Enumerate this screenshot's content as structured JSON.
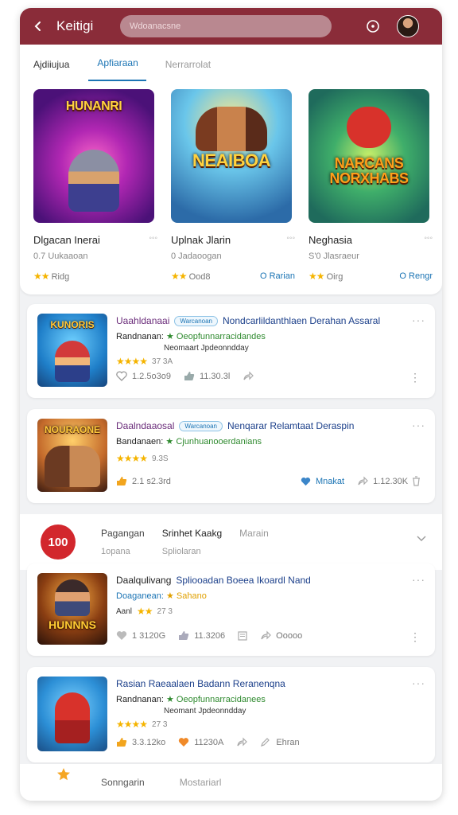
{
  "header": {
    "back_icon": "chevron-left-icon",
    "title": "Keitigi",
    "search_placeholder": "Wdoanacsne",
    "info_icon": "info-circle-icon",
    "avatar_icon": "user-avatar"
  },
  "tabs": [
    {
      "label": "Ajdiiujua"
    },
    {
      "label": "Apfiaraan"
    },
    {
      "label": "Nerrarrolat"
    }
  ],
  "featured": [
    {
      "art": "HUNANRI",
      "name": "Dlgacan Inerai",
      "meta": "◦◦◦",
      "sub": "0.7 Uukaaoan",
      "rating": "Ridg",
      "stars": "★★",
      "link": ""
    },
    {
      "art": "NEAIBOA",
      "name": "Uplnak Jlarin",
      "meta": "◦◦◦",
      "sub": "0 Jadaoogan",
      "rating": "Ood8",
      "stars": "★★",
      "link": "O Rarian"
    },
    {
      "art": "NARCANS NORXHABS",
      "name": "Neghasia",
      "meta": "◦◦◦",
      "sub": "S'0 Jlasraeur",
      "rating": "Oirg",
      "stars": "★★",
      "link": "O Rengr"
    }
  ],
  "list": [
    {
      "art": "KUNORIS",
      "title_a": "Uaahldanaai",
      "badge": "Warcanoan",
      "title_b": "Nondcarlildanthlaen Derahan Assaral",
      "sub_a": "Randnanan:",
      "sub_b": "★ Oeopfunnarracidandes",
      "meta": "Neomaart Jpdeonndday",
      "stars": "★★★★",
      "rating": "37 3A",
      "act1": "1.2.5o3o9",
      "act2": "11.30.3l",
      "act3": ""
    },
    {
      "art": "NOURAONE",
      "title_a": "Daalndaaosal",
      "badge": "Warcanoan",
      "title_b": "Nenqarar Relamtaat Deraspin",
      "sub_a": "Bandanaen:",
      "sub_b": "★ Cjunhuanooerdanians",
      "meta": "",
      "stars": "★★★★",
      "rating": "9.3S",
      "act1": "2.1 s2.3rd",
      "act2": "Mnakat",
      "act3": "1.12.30K"
    },
    {
      "art": "HUNNNS",
      "title_a": "Daalqulivang",
      "badge": "",
      "title_b": "Spliooadan Boeea Ikoardl Nand",
      "sub_a": "Doaganean:",
      "sub_b": "★ Sahano",
      "meta": "Aanl",
      "stars": "★★",
      "rating": "27 3",
      "act1": "1 3120G",
      "act2": "11.3206",
      "act3": "Ooooo"
    },
    {
      "art": "",
      "title_a": "",
      "badge": "",
      "title_b": "Rasian Raeaalaen Badann Reranenqna",
      "sub_a": "Randnanan:",
      "sub_b": "★ Oeopfunnarracidanees",
      "meta": "Neomant Jpdeonndday",
      "stars": "★★★★",
      "rating": "27 3",
      "act1": "3.3.12ko",
      "act2": "11230A",
      "act3": "Ehran"
    }
  ],
  "strip": {
    "rank": "100",
    "col1_top": "Pagangan",
    "col1_bot": "1opana",
    "col2_top": "Srinhet Kaakg",
    "col2_bot": "Spliolaran",
    "col3_top": "Marain"
  },
  "bottom_nav": {
    "item1": "Sonngarin",
    "item2": "Mostariarl"
  }
}
